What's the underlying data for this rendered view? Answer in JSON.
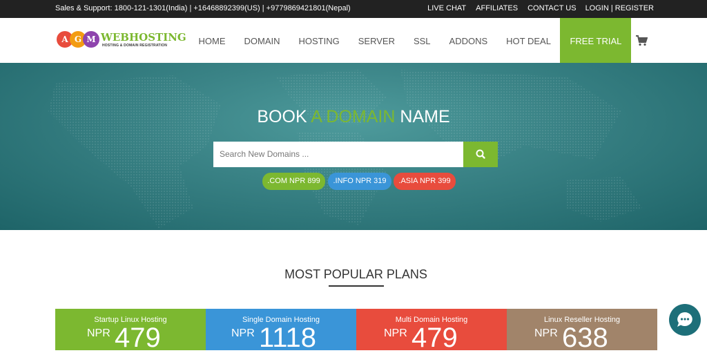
{
  "topbar": {
    "support": "Sales & Support: 1800-121-1301(India) | +16468892399(US) | +9779869421801(Nepal)",
    "links": [
      "LIVE CHAT",
      "AFFILIATES",
      "CONTACT US",
      "LOGIN | REGISTER"
    ]
  },
  "logo": {
    "letters": [
      "A",
      "G",
      "M"
    ],
    "text": "WEBHOSTING",
    "subtext": "HOSTING & DOMAIN REGISTRATION"
  },
  "nav": {
    "items": [
      "HOME",
      "DOMAIN",
      "HOSTING",
      "SERVER",
      "SSL",
      "ADDONS",
      "HOT DEAL"
    ],
    "free_trial": "FREE TRIAL",
    "cart_icon": "cart-icon"
  },
  "hero": {
    "title_start": "BOOK ",
    "title_accent": "A DOMAIN",
    "title_end": " NAME",
    "search_placeholder": "Search New Domains ...",
    "search_icon": "search-icon",
    "tlds": [
      ".COM NPR 899",
      ".INFO NPR 319",
      ".ASIA NPR 399"
    ]
  },
  "plans": {
    "title": "MOST POPULAR PLANS",
    "cards": [
      {
        "name": "Startup Linux Hosting",
        "currency": "NPR",
        "price": "479",
        "color": "#7cb830"
      },
      {
        "name": "Single Domain Hosting",
        "currency": "NPR",
        "price": "1118",
        "color": "#3a95d8"
      },
      {
        "name": "Multi Domain Hosting",
        "currency": "NPR",
        "price": "479",
        "color": "#e84c3d"
      },
      {
        "name": "Linux Reseller Hosting",
        "currency": "NPR",
        "price": "638",
        "color": "#a1846a"
      }
    ]
  },
  "colors": {
    "accent_green": "#7cb830",
    "blue": "#3a95d8",
    "red": "#e84c3d",
    "brown": "#a1846a",
    "topbar": "#222222",
    "hero_teal": "#3a8386"
  },
  "chat_icon": "chat-bubble-icon"
}
